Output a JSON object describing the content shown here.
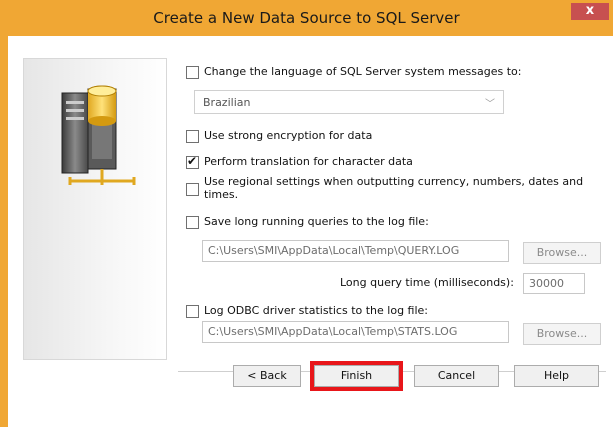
{
  "window": {
    "title": "Create a New Data Source to SQL Server",
    "close_glyph": "x"
  },
  "options": {
    "change_language_label": "Change the language of SQL Server system messages to:",
    "language_value": "Brazilian",
    "strong_encryption_label": "Use strong encryption for data",
    "translation_label": "Perform translation for character data",
    "regional_label": "Use regional settings when outputting currency, numbers, dates and times.",
    "long_queries_label": "Save long running queries to the log file:",
    "query_log_path": "C:\\Users\\SMI\\AppData\\Local\\Temp\\QUERY.LOG",
    "browse_label": "Browse...",
    "long_query_time_label": "Long query time (milliseconds):",
    "long_query_time_value": "30000",
    "odbc_stats_label": "Log ODBC driver statistics to the log file:",
    "stats_log_path": "C:\\Users\\SMI\\AppData\\Local\\Temp\\STATS.LOG",
    "browse2_label": "Browse..."
  },
  "buttons": {
    "back": "< Back",
    "finish": "Finish",
    "cancel": "Cancel",
    "help": "Help"
  },
  "colors": {
    "title_bar": "#f0a734",
    "close_button": "#c75050",
    "highlight": "#e8161a"
  }
}
